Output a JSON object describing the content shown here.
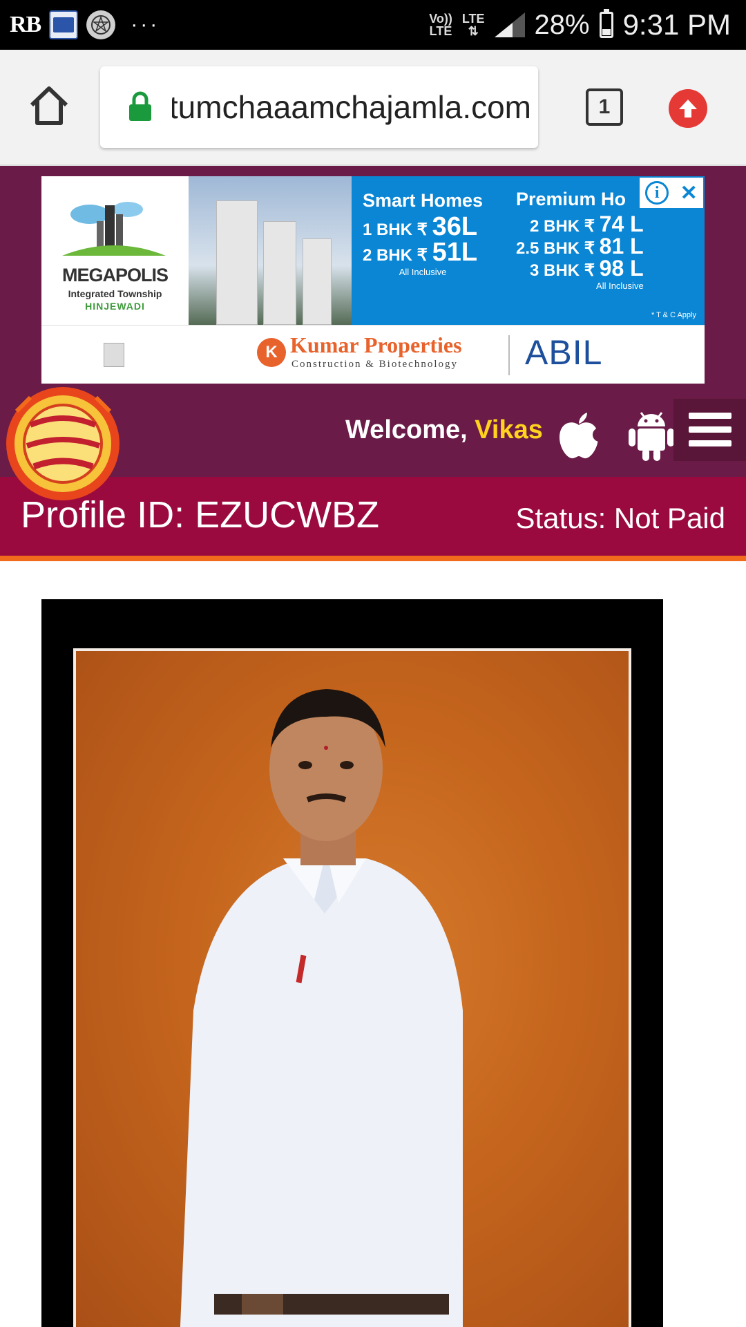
{
  "status_bar": {
    "app_initials": "RB",
    "network_volte": "Vo))\nLTE",
    "network_lte": "LTE",
    "battery_percent": "28%",
    "time": "9:31 PM",
    "overflow": "···"
  },
  "browser": {
    "url": "tumchaaamchajamla.com",
    "tab_count": "1"
  },
  "ad": {
    "brand": "MEGAPOLIS",
    "brand_sub": "Integrated Township",
    "brand_location": "HINJEWADI",
    "col1_heading": "Smart Homes",
    "col1_rows": [
      {
        "bhk": "1 BHK ₹",
        "price": "36L"
      },
      {
        "bhk": "2 BHK ₹",
        "price": "51L"
      }
    ],
    "col1_note": "All Inclusive",
    "col2_heading": "Premium Ho",
    "col2_rows": [
      {
        "bhk": "2 BHK ₹",
        "price": "74 L"
      },
      {
        "bhk": "2.5 BHK ₹",
        "price": "81 L"
      },
      {
        "bhk": "3 BHK ₹",
        "price": "98 L"
      }
    ],
    "col2_note": "All Inclusive",
    "terms": "* T & C Apply",
    "developer": "Kumar Properties",
    "developer_sub": "Construction & Biotechnology",
    "partner": "ABIL",
    "close": "✕",
    "info": "i"
  },
  "nav": {
    "welcome_prefix": "Welcome,",
    "user_name": "Vikas"
  },
  "profile": {
    "id_label": "Profile ID: EZUCWBZ",
    "status_label": "Status: Not Paid"
  },
  "colors": {
    "site_maroon": "#6a1b47",
    "profile_bar": "#9b0a3f",
    "accent_orange": "#f26a1b",
    "welcome_name": "#ffd21f"
  }
}
